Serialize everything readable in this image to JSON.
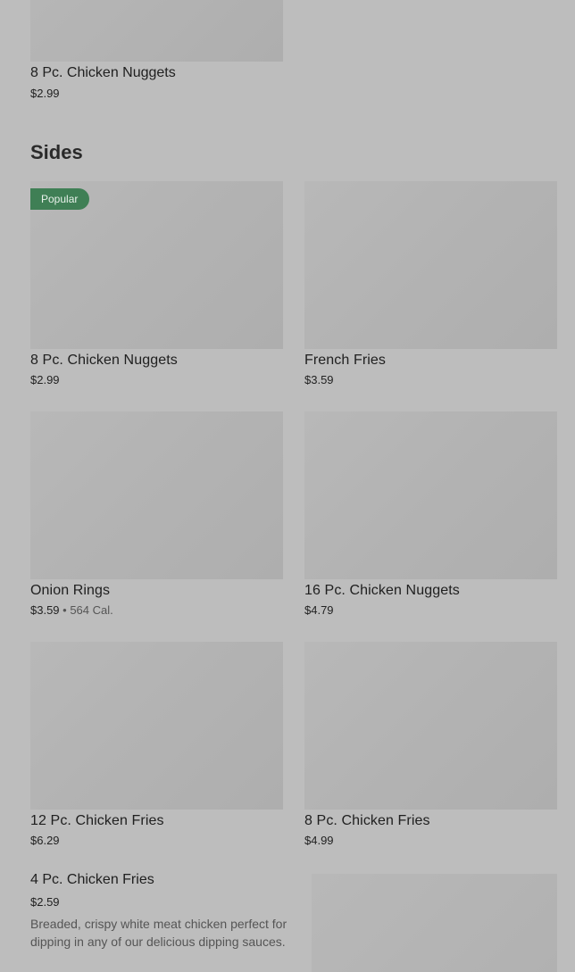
{
  "top_item": {
    "name": "8 Pc. Chicken Nuggets",
    "price": "$2.99"
  },
  "section": {
    "title": "Sides"
  },
  "items": [
    {
      "name": "8 Pc. Chicken Nuggets",
      "price": "$2.99",
      "badge": "Popular"
    },
    {
      "name": "French Fries",
      "price": "$3.59"
    },
    {
      "name": "Onion Rings",
      "price": "$3.59",
      "separator": " • ",
      "calories": "564 Cal."
    },
    {
      "name": "16 Pc. Chicken Nuggets",
      "price": "$4.79"
    },
    {
      "name": "12 Pc. Chicken Fries",
      "price": "$6.29"
    },
    {
      "name": "8 Pc. Chicken Fries",
      "price": "$4.99"
    }
  ],
  "featured_item": {
    "name": "4 Pc. Chicken Fries",
    "price": "$2.59",
    "description": "Breaded, crispy white meat chicken perfect for dipping in any of our delicious dipping sauces."
  }
}
